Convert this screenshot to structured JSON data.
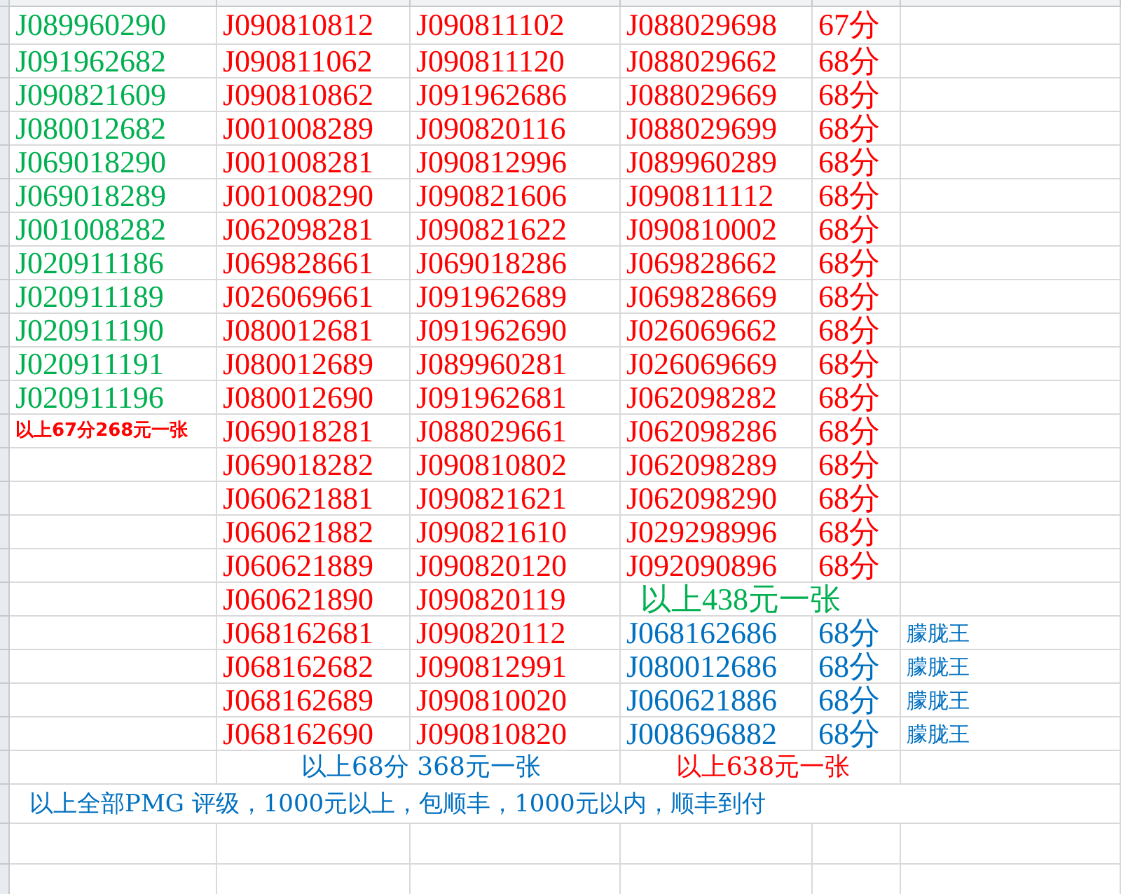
{
  "rows": [
    {
      "column_1": {
        "text": "J089960290",
        "color": "#00b050"
      },
      "column_2": {
        "text": "J090810812",
        "color": "#ff0000"
      },
      "column_3": {
        "text": "J090811102",
        "color": "#ff0000"
      },
      "column_4": {
        "text": "J088029698",
        "color": "#ff0000"
      },
      "column_5": {
        "text": "67分",
        "color": "#ff0000"
      }
    },
    {
      "column_1": {
        "text": "J091962682",
        "color": "#00b050"
      },
      "column_2": {
        "text": "J090811062",
        "color": "#ff0000"
      },
      "column_3": {
        "text": "J090811120",
        "color": "#ff0000"
      },
      "column_4": {
        "text": "J088029662",
        "color": "#ff0000"
      },
      "column_5": {
        "text": "68分",
        "color": "#ff0000"
      }
    },
    {
      "column_1": {
        "text": "J090821609",
        "color": "#00b050"
      },
      "column_2": {
        "text": "J090810862",
        "color": "#ff0000"
      },
      "column_3": {
        "text": "J091962686",
        "color": "#ff0000"
      },
      "column_4": {
        "text": "J088029669",
        "color": "#ff0000"
      },
      "column_5": {
        "text": "68分",
        "color": "#ff0000"
      }
    },
    {
      "column_1": {
        "text": "J080012682",
        "color": "#00b050"
      },
      "column_2": {
        "text": "J001008289",
        "color": "#ff0000"
      },
      "column_3": {
        "text": "J090820116",
        "color": "#ff0000"
      },
      "column_4": {
        "text": "J088029699",
        "color": "#ff0000"
      },
      "column_5": {
        "text": "68分",
        "color": "#ff0000"
      }
    },
    {
      "column_1": {
        "text": "J069018290",
        "color": "#00b050"
      },
      "column_2": {
        "text": "J001008281",
        "color": "#ff0000"
      },
      "column_3": {
        "text": "J090812996",
        "color": "#ff0000"
      },
      "column_4": {
        "text": "J089960289",
        "color": "#ff0000"
      },
      "column_5": {
        "text": "68分",
        "color": "#ff0000"
      }
    },
    {
      "column_1": {
        "text": "J069018289",
        "color": "#00b050"
      },
      "column_2": {
        "text": "J001008290",
        "color": "#ff0000"
      },
      "column_3": {
        "text": "J090821606",
        "color": "#ff0000"
      },
      "column_4": {
        "text": "J090811112",
        "color": "#ff0000"
      },
      "column_5": {
        "text": "68分",
        "color": "#ff0000"
      }
    },
    {
      "column_1": {
        "text": "J001008282",
        "color": "#00b050"
      },
      "column_2": {
        "text": "J062098281",
        "color": "#ff0000"
      },
      "column_3": {
        "text": "J090821622",
        "color": "#ff0000"
      },
      "column_4": {
        "text": "J090810002",
        "color": "#ff0000"
      },
      "column_5": {
        "text": "68分",
        "color": "#ff0000"
      }
    },
    {
      "column_1": {
        "text": "J020911186",
        "color": "#00b050"
      },
      "column_2": {
        "text": "J069828661",
        "color": "#ff0000"
      },
      "column_3": {
        "text": "J069018286",
        "color": "#ff0000"
      },
      "column_4": {
        "text": "J069828662",
        "color": "#ff0000"
      },
      "column_5": {
        "text": "68分",
        "color": "#ff0000"
      }
    },
    {
      "column_1": {
        "text": "J020911189",
        "color": "#00b050"
      },
      "column_2": {
        "text": "J026069661",
        "color": "#ff0000"
      },
      "column_3": {
        "text": "J091962689",
        "color": "#ff0000"
      },
      "column_4": {
        "text": "J069828669",
        "color": "#ff0000"
      },
      "column_5": {
        "text": "68分",
        "color": "#ff0000"
      }
    },
    {
      "column_1": {
        "text": "J020911190",
        "color": "#00b050"
      },
      "column_2": {
        "text": "J080012681",
        "color": "#ff0000"
      },
      "column_3": {
        "text": "J091962690",
        "color": "#ff0000"
      },
      "column_4": {
        "text": "J026069662",
        "color": "#ff0000"
      },
      "column_5": {
        "text": "68分",
        "color": "#ff0000"
      }
    },
    {
      "column_1": {
        "text": "J020911191",
        "color": "#00b050"
      },
      "column_2": {
        "text": "J080012689",
        "color": "#ff0000"
      },
      "column_3": {
        "text": "J089960281",
        "color": "#ff0000"
      },
      "column_4": {
        "text": "J026069669",
        "color": "#ff0000"
      },
      "column_5": {
        "text": "68分",
        "color": "#ff0000"
      }
    },
    {
      "column_1": {
        "text": "J020911196",
        "color": "#00b050"
      },
      "column_2": {
        "text": "J080012690",
        "color": "#ff0000"
      },
      "column_3": {
        "text": "J091962681",
        "color": "#ff0000"
      },
      "column_4": {
        "text": "J062098282",
        "color": "#ff0000"
      },
      "column_5": {
        "text": "68分",
        "color": "#ff0000"
      }
    },
    {
      "column_1": {
        "text": "以上67分268元一张",
        "color": "#ff0000",
        "kind": "note"
      },
      "column_2": {
        "text": "J069018281",
        "color": "#ff0000"
      },
      "column_3": {
        "text": "J088029661",
        "color": "#ff0000"
      },
      "column_4": {
        "text": "J062098286",
        "color": "#ff0000"
      },
      "column_5": {
        "text": "68分",
        "color": "#ff0000"
      }
    },
    {
      "column_2": {
        "text": "J069018282",
        "color": "#ff0000"
      },
      "column_3": {
        "text": "J090810802",
        "color": "#ff0000"
      },
      "column_4": {
        "text": "J062098289",
        "color": "#ff0000"
      },
      "column_5": {
        "text": "68分",
        "color": "#ff0000"
      }
    },
    {
      "column_2": {
        "text": "J060621881",
        "color": "#ff0000"
      },
      "column_3": {
        "text": "J090821621",
        "color": "#ff0000"
      },
      "column_4": {
        "text": "J062098290",
        "color": "#ff0000"
      },
      "column_5": {
        "text": "68分",
        "color": "#ff0000"
      }
    },
    {
      "column_2": {
        "text": "J060621882",
        "color": "#ff0000"
      },
      "column_3": {
        "text": "J090821610",
        "color": "#ff0000"
      },
      "column_4": {
        "text": "J029298996",
        "color": "#ff0000"
      },
      "column_5": {
        "text": "68分",
        "color": "#ff0000"
      }
    },
    {
      "column_2": {
        "text": "J060621889",
        "color": "#ff0000"
      },
      "column_3": {
        "text": "J090820120",
        "color": "#ff0000"
      },
      "column_4": {
        "text": "J092090896",
        "color": "#ff0000"
      },
      "column_5": {
        "text": "68分",
        "color": "#ff0000"
      }
    },
    {
      "column_2": {
        "text": "J060621890",
        "color": "#ff0000"
      },
      "column_3": {
        "text": "J090820119",
        "color": "#ff0000"
      },
      "column_4_to_5": {
        "text": "以上438元一张",
        "color": "#00b050"
      }
    },
    {
      "column_2": {
        "text": "J068162681",
        "color": "#ff0000"
      },
      "column_3": {
        "text": "J090820112",
        "color": "#ff0000"
      },
      "column_4": {
        "text": "J068162686",
        "color": "#0070c0"
      },
      "column_5": {
        "text": "68分",
        "color": "#0070c0"
      },
      "column_6": {
        "text": "朦胧王",
        "color": "#0070c0",
        "kind": "note"
      }
    },
    {
      "column_2": {
        "text": "J068162682",
        "color": "#ff0000"
      },
      "column_3": {
        "text": "J090812991",
        "color": "#ff0000"
      },
      "column_4": {
        "text": "J080012686",
        "color": "#0070c0"
      },
      "column_5": {
        "text": "68分",
        "color": "#0070c0"
      },
      "column_6": {
        "text": "朦胧王",
        "color": "#0070c0",
        "kind": "note"
      }
    },
    {
      "column_2": {
        "text": "J068162689",
        "color": "#ff0000"
      },
      "column_3": {
        "text": "J090810020",
        "color": "#ff0000"
      },
      "column_4": {
        "text": "J060621886",
        "color": "#0070c0"
      },
      "column_5": {
        "text": "68分",
        "color": "#0070c0"
      },
      "column_6": {
        "text": "朦胧王",
        "color": "#0070c0",
        "kind": "note"
      }
    },
    {
      "column_2": {
        "text": "J068162690",
        "color": "#ff0000"
      },
      "column_3": {
        "text": "J090810820",
        "color": "#ff0000"
      },
      "column_4": {
        "text": "J008696882",
        "color": "#0070c0"
      },
      "column_5": {
        "text": "68分",
        "color": "#0070c0"
      },
      "column_6": {
        "text": "朦胧王",
        "color": "#0070c0",
        "kind": "note"
      }
    },
    {
      "column_2_to_3": {
        "text": "以上68分  368元一张",
        "color": "#0070c0"
      },
      "column_4_to_5": {
        "text": "以上638元一张",
        "color": "#ff0000"
      }
    },
    {
      "column_1_to_6": {
        "text": "以上全部PMG 评级，1000元以上，包顺丰，1000元以内，顺丰到付",
        "color": "#0070c0"
      }
    }
  ]
}
